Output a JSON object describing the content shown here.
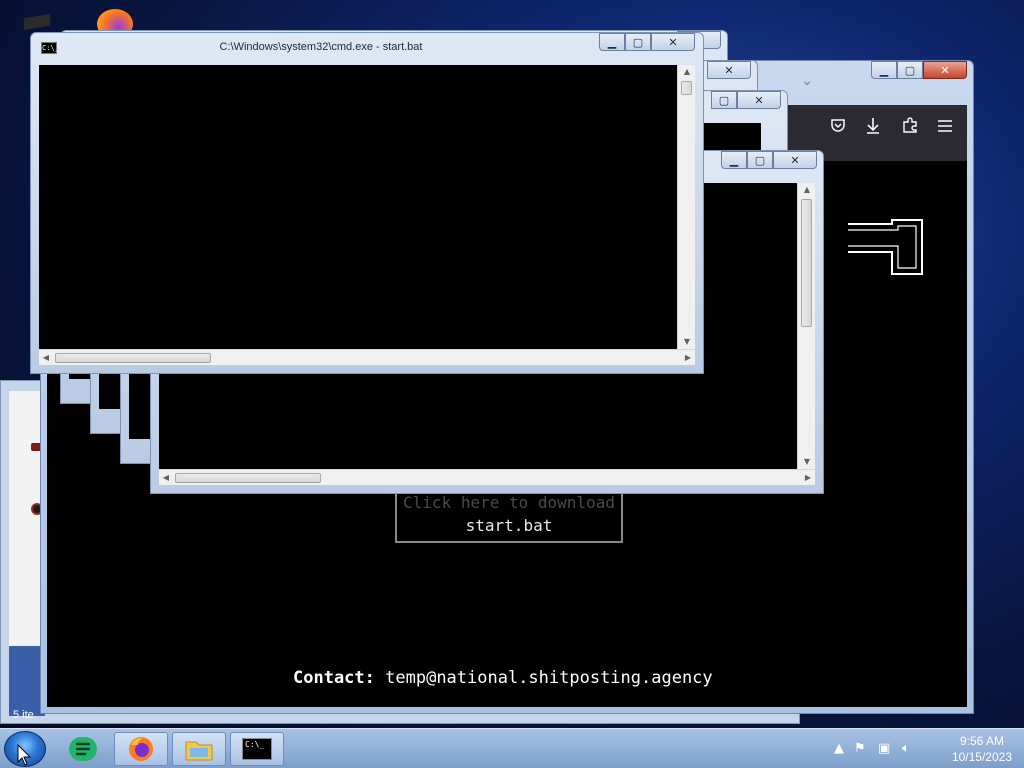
{
  "desktop": {
    "explorer_status": "5 ite"
  },
  "browser": {
    "title_icons": [
      "pocket-icon",
      "download-icon",
      "extensions-icon",
      "menu-icon"
    ],
    "page": {
      "download_line1": "Click here to download",
      "download_line2": "start.bat",
      "contact_label": "Contact:",
      "contact_email": "temp@national.shitposting.agency"
    }
  },
  "cmd_windows": {
    "front_title": "C:\\Windows\\system32\\cmd.exe - start.bat",
    "icon_text": "C:\\_"
  },
  "taskbar": {
    "apps": [
      {
        "name": "sheets-app",
        "icon": "sheets-icon"
      },
      {
        "name": "firefox",
        "icon": "firefox-icon"
      },
      {
        "name": "file-explorer",
        "icon": "folder-icon"
      },
      {
        "name": "cmd",
        "icon": "cmd-icon",
        "label": "C:\\_"
      }
    ],
    "clock": {
      "time": "9:56 AM",
      "date": "10/15/2023"
    }
  },
  "colors": {
    "terminal_bg": "#000000",
    "accent_green": "#1fb56b",
    "close_red": "#c7442c"
  }
}
